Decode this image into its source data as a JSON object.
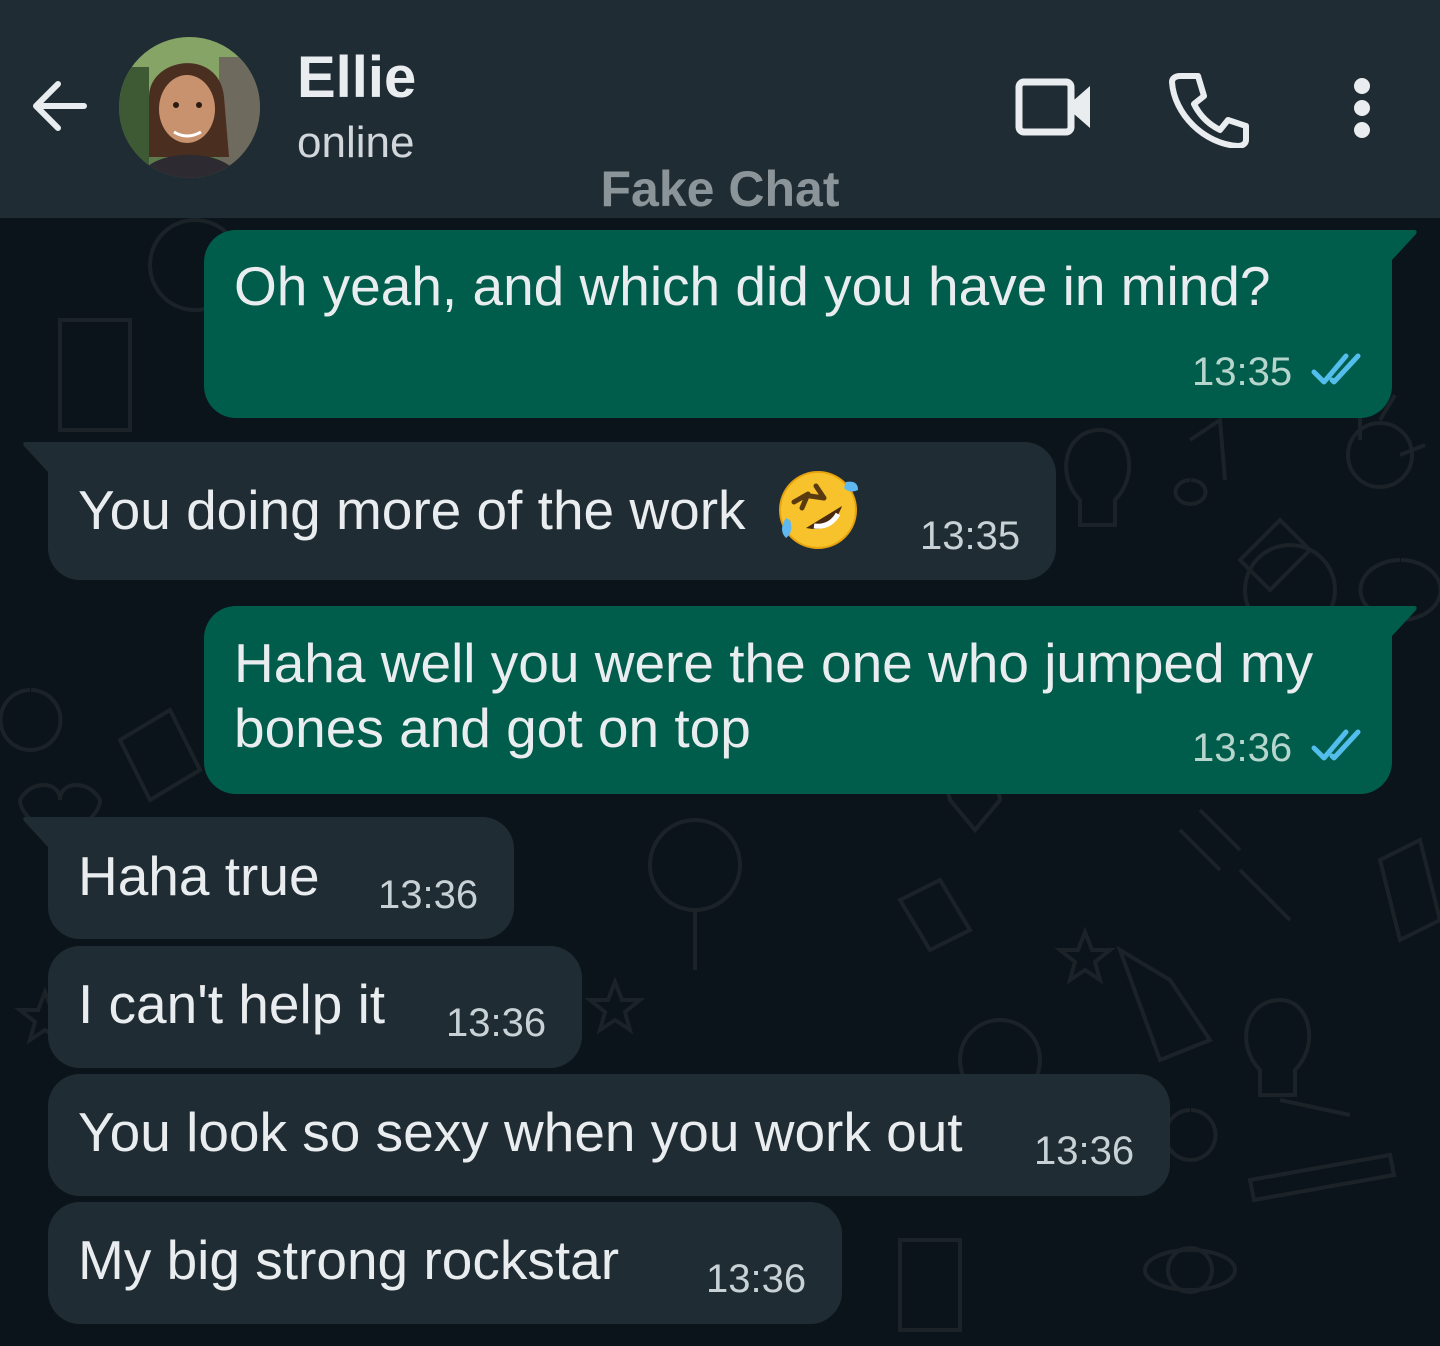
{
  "header": {
    "contact_name": "Ellie",
    "status": "online",
    "watermark": "Fake Chat",
    "icons": [
      "back-arrow-icon",
      "avatar",
      "video-call-icon",
      "phone-icon",
      "more-vert-icon"
    ]
  },
  "colors": {
    "header_bg": "#1f2c34",
    "chat_bg": "#0b141a",
    "outgoing_bubble": "#005c4b",
    "incoming_bubble": "#202c33",
    "read_ticks": "#53bdeb"
  },
  "messages": [
    {
      "direction": "outgoing",
      "text": "Oh yeah, and which did you have in mind?",
      "time": "13:35",
      "read": true
    },
    {
      "direction": "incoming",
      "text": "You doing more of the work",
      "emoji": "rolling-on-floor-laughing",
      "time": "13:35"
    },
    {
      "direction": "outgoing",
      "line1": "Haha well you were the one who jumped my",
      "line2": "bones and got on top",
      "time": "13:36",
      "read": true
    },
    {
      "direction": "incoming",
      "text": "Haha true",
      "time": "13:36"
    },
    {
      "direction": "incoming",
      "text": "I can't help it",
      "time": "13:36"
    },
    {
      "direction": "incoming",
      "text": "You look so sexy when you work out",
      "time": "13:36"
    },
    {
      "direction": "incoming",
      "text": "My big strong rockstar",
      "time": "13:36"
    }
  ]
}
